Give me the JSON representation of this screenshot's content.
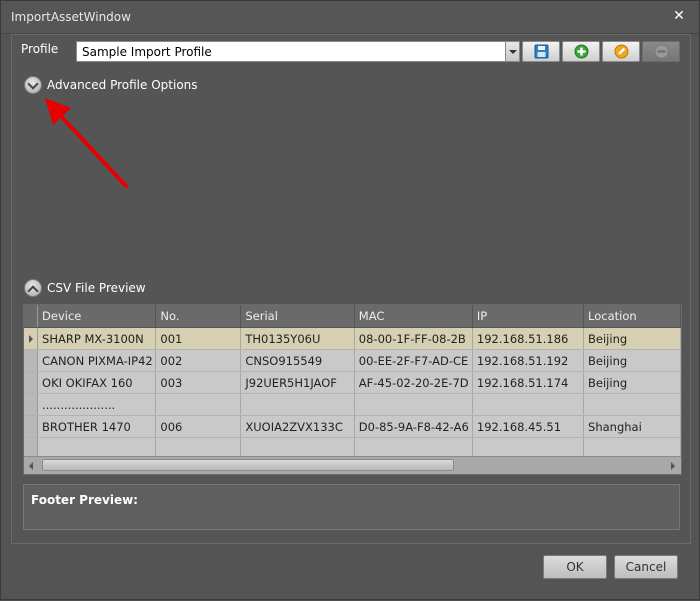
{
  "window": {
    "title": "ImportAssetWindow",
    "close_icon": "close-icon"
  },
  "profile": {
    "label": "Profile",
    "selected_value": "Sample Import Profile",
    "toolbar_icons": [
      "save-icon",
      "add-icon",
      "edit-icon",
      "remove-icon"
    ],
    "remove_disabled": true
  },
  "advanced": {
    "label": "Advanced Profile Options",
    "expanded": false
  },
  "csv": {
    "label": "CSV File Preview",
    "expanded": true,
    "columns": [
      "Device",
      "No.",
      "Serial",
      "MAC",
      "IP",
      "Location"
    ],
    "rows": [
      [
        "SHARP MX-3100N",
        "001",
        "TH0135Y06U",
        "08-00-1F-FF-08-2B",
        "192.168.51.186",
        "Beijing"
      ],
      [
        "CANON PIXMA-IP42",
        "002",
        "CNSO915549",
        "00-EE-2F-F7-AD-CE",
        "192.168.51.192",
        "Beijing"
      ],
      [
        "OKI OKIFAX 160",
        "003",
        "J92UER5H1JAOF",
        "AF-45-02-20-2E-7D",
        "192.168.51.174",
        "Beijing"
      ],
      [
        "....................",
        "",
        "",
        "",
        "",
        ""
      ],
      [
        "BROTHER 1470",
        "006",
        "XUOIA2ZVX133C",
        "D0-85-9A-F8-42-A6",
        "192.168.45.51",
        "Shanghai"
      ],
      [
        "",
        "",
        "",
        "",
        "",
        ""
      ]
    ],
    "selected_row": 0
  },
  "footer": {
    "label": "Footer Preview:"
  },
  "buttons": {
    "ok": "OK",
    "cancel": "Cancel"
  },
  "colors": {
    "selected_row": "#d7cfb1",
    "annotation_arrow": "#e60000"
  }
}
